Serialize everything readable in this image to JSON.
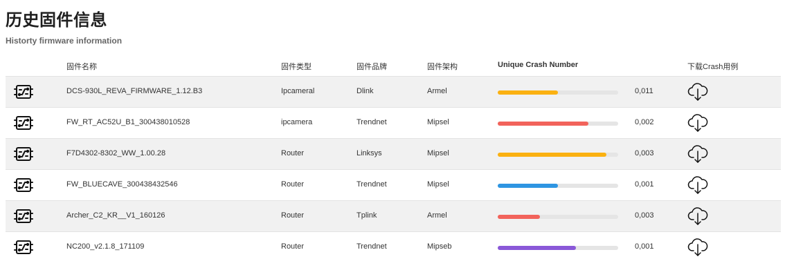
{
  "page": {
    "title": "历史固件信息",
    "subtitle": "Historty firmware information"
  },
  "table": {
    "columns": {
      "name": "固件名称",
      "type": "固件类型",
      "brand": "固件品牌",
      "arch": "固件架构",
      "crash": "Unique Crash Number",
      "download": "下载Crash用例"
    },
    "rows": [
      {
        "name": "DCS-930L_REVA_FIRMWARE_1.12.B3",
        "type": "Ipcameral",
        "brand": "Dlink",
        "arch": "Armel",
        "crash_value": "0,011",
        "bar_fraction": 0.5,
        "bar_color": "#fbb111"
      },
      {
        "name": "FW_RT_AC52U_B1_300438010528",
        "type": "ipcamera",
        "brand": "Trendnet",
        "arch": "Mipsel",
        "crash_value": "0,002",
        "bar_fraction": 0.75,
        "bar_color": "#f2635b"
      },
      {
        "name": "F7D4302-8302_WW_1.00.28",
        "type": "Router",
        "brand": "Linksys",
        "arch": "Mipsel",
        "crash_value": "0,003",
        "bar_fraction": 0.9,
        "bar_color": "#fbb111"
      },
      {
        "name": "FW_BLUECAVE_300438432546",
        "type": "Router",
        "brand": "Trendnet",
        "arch": "Mipsel",
        "crash_value": "0,001",
        "bar_fraction": 0.5,
        "bar_color": "#2e95e2"
      },
      {
        "name": "Archer_C2_KR__V1_160126",
        "type": "Router",
        "brand": "Tplink",
        "arch": "Armel",
        "crash_value": "0,003",
        "bar_fraction": 0.35,
        "bar_color": "#f2635b"
      },
      {
        "name": "NC200_v2.1.8_171109",
        "type": "Router",
        "brand": "Trendnet",
        "arch": "Mipseb",
        "crash_value": "0,001",
        "bar_fraction": 0.65,
        "bar_color": "#8a58d8"
      }
    ]
  },
  "icons": {
    "firmware": "firmware-chip-icon",
    "download": "cloud-download-icon"
  }
}
